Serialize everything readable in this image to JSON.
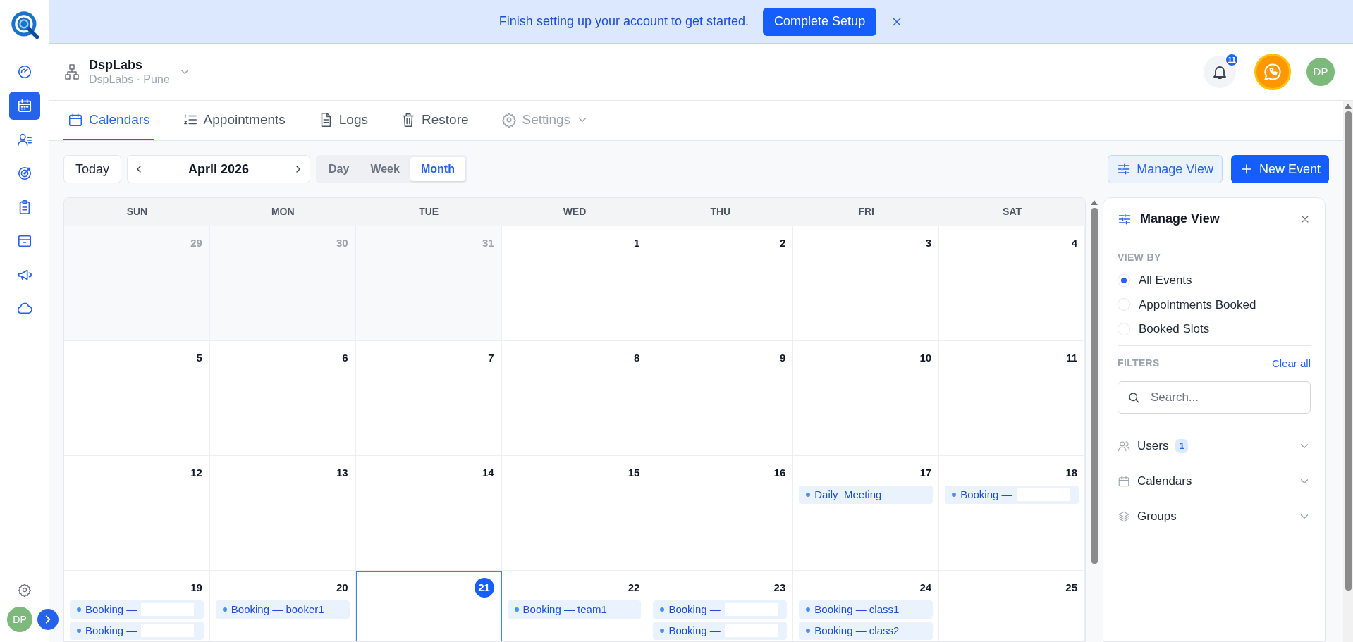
{
  "banner": {
    "message": "Finish setting up your account to get started.",
    "button": "Complete Setup"
  },
  "sidebar": {
    "items": [
      {
        "selected": false
      },
      {
        "selected": true
      },
      {
        "selected": false
      },
      {
        "selected": false
      },
      {
        "selected": false
      },
      {
        "selected": false
      },
      {
        "selected": false
      },
      {
        "selected": false
      }
    ],
    "avatar": "DP"
  },
  "header": {
    "org_name": "DspLabs",
    "org_location": "DspLabs · Pune",
    "notifications": "11",
    "avatar": "DP"
  },
  "tabs": [
    {
      "label": "Calendars",
      "selected": true,
      "disabled": false
    },
    {
      "label": "Appointments",
      "selected": false,
      "disabled": false
    },
    {
      "label": "Logs",
      "selected": false,
      "disabled": false
    },
    {
      "label": "Restore",
      "selected": false,
      "disabled": false
    },
    {
      "label": "Settings",
      "selected": false,
      "disabled": true
    }
  ],
  "toolbar": {
    "today": "Today",
    "period": "April 2026",
    "views": [
      {
        "label": "Day",
        "selected": false
      },
      {
        "label": "Week",
        "selected": false
      },
      {
        "label": "Month",
        "selected": true
      }
    ],
    "manage_view": "Manage View",
    "new_event": "New Event"
  },
  "calendar": {
    "weekdays": [
      "SUN",
      "MON",
      "TUE",
      "WED",
      "THU",
      "FRI",
      "SAT"
    ],
    "weeks": [
      [
        {
          "day": "29",
          "muted": true,
          "today": false
        },
        {
          "day": "30",
          "muted": true,
          "today": false
        },
        {
          "day": "31",
          "muted": true,
          "today": false
        },
        {
          "day": "1",
          "muted": false,
          "today": false
        },
        {
          "day": "2",
          "muted": false,
          "today": false
        },
        {
          "day": "3",
          "muted": false,
          "today": false
        },
        {
          "day": "4",
          "muted": false,
          "today": false
        }
      ],
      [
        {
          "day": "5",
          "muted": false,
          "today": false
        },
        {
          "day": "6",
          "muted": false,
          "today": false
        },
        {
          "day": "7",
          "muted": false,
          "today": false
        },
        {
          "day": "8",
          "muted": false,
          "today": false
        },
        {
          "day": "9",
          "muted": false,
          "today": false
        },
        {
          "day": "10",
          "muted": false,
          "today": false
        },
        {
          "day": "11",
          "muted": false,
          "today": false
        }
      ],
      [
        {
          "day": "12",
          "muted": false,
          "today": false
        },
        {
          "day": "13",
          "muted": false,
          "today": false
        },
        {
          "day": "14",
          "muted": false,
          "today": false
        },
        {
          "day": "15",
          "muted": false,
          "today": false
        },
        {
          "day": "16",
          "muted": false,
          "today": false
        },
        {
          "day": "17",
          "muted": false,
          "today": false,
          "events": [
            {
              "label": "Daily_Meeting",
              "redacted": false
            }
          ]
        },
        {
          "day": "18",
          "muted": false,
          "today": false,
          "events": [
            {
              "label": "Booking —",
              "redacted": true
            }
          ]
        }
      ],
      [
        {
          "day": "19",
          "muted": false,
          "today": false,
          "events": [
            {
              "label": "Booking —",
              "redacted": true
            },
            {
              "label": "Booking —",
              "redacted": true
            }
          ]
        },
        {
          "day": "20",
          "muted": false,
          "today": false,
          "events": [
            {
              "label": "Booking — booker1",
              "redacted": false
            }
          ]
        },
        {
          "day": "21",
          "muted": false,
          "today": true
        },
        {
          "day": "22",
          "muted": false,
          "today": false,
          "events": [
            {
              "label": "Booking — team1",
              "redacted": false
            }
          ]
        },
        {
          "day": "23",
          "muted": false,
          "today": false,
          "events": [
            {
              "label": "Booking —",
              "redacted": true
            },
            {
              "label": "Booking —",
              "redacted": true
            }
          ]
        },
        {
          "day": "24",
          "muted": false,
          "today": false,
          "events": [
            {
              "label": "Booking — class1",
              "redacted": false
            },
            {
              "label": "Booking — class2",
              "redacted": false
            }
          ]
        },
        {
          "day": "25",
          "muted": false,
          "today": false
        }
      ]
    ]
  },
  "manage_panel": {
    "title": "Manage View",
    "view_by_label": "VIEW BY",
    "view_by": [
      {
        "label": "All Events",
        "selected": true
      },
      {
        "label": "Appointments Booked",
        "selected": false
      },
      {
        "label": "Booked Slots",
        "selected": false
      }
    ],
    "filters_label": "FILTERS",
    "clear_all": "Clear all",
    "search_placeholder": "Search...",
    "filters": [
      {
        "label": "Users",
        "count": "1"
      },
      {
        "label": "Calendars"
      },
      {
        "label": "Groups"
      }
    ]
  }
}
